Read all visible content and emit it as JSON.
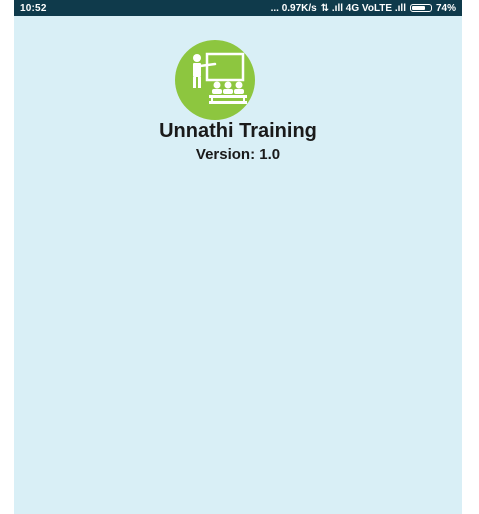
{
  "status_bar": {
    "time": "10:52",
    "network_speed": "... 0.97K/s",
    "network_info": "⇅ .ıll 4G VoLTE .ıll",
    "battery_level": 0.74,
    "battery_text": "74%"
  },
  "splash": {
    "logo_icon": "classroom-training-icon",
    "title": "Unnathi Training",
    "version": "Version: 1.0"
  },
  "colors": {
    "status_bar_bg": "#0f3a4b",
    "screen_bg": "#d9eff6",
    "logo_green": "#8dc63f",
    "text": "#1a1a1a"
  }
}
